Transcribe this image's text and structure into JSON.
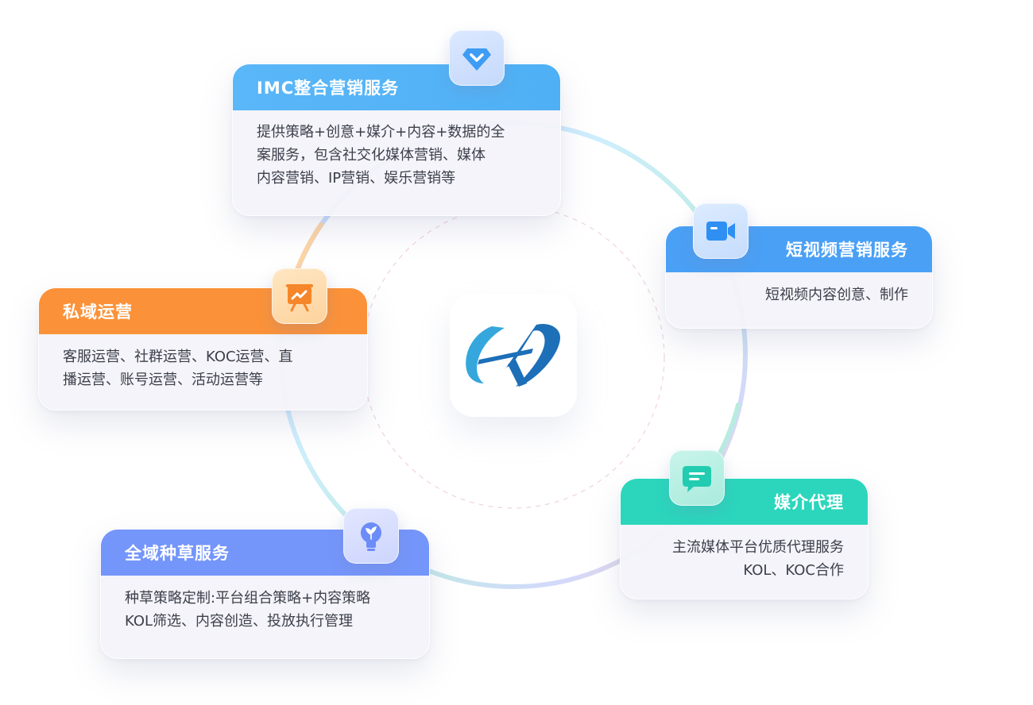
{
  "colors": {
    "imc": "#54b4f7",
    "short_video": "#4a9ff5",
    "private": "#fa9137",
    "media": "#2bd7bd",
    "grass": "#7494f9",
    "logo_blue": "#1d6fb8",
    "logo_light": "#35a7dd"
  },
  "logo": {
    "icon": "hv-logo-mark"
  },
  "cards": {
    "imc": {
      "title": "IMC整合营销服务",
      "lines": [
        "提供策略+创意+媒介+内容+数据的全",
        "案服务，包含社交化媒体营销、媒体",
        "内容营销、IP营销、娱乐营销等"
      ],
      "icon": "diamond-icon"
    },
    "short_video": {
      "title": "短视频营销服务",
      "lines": [
        "短视频内容创意、制作"
      ],
      "icon": "video-camera-icon"
    },
    "private": {
      "title": "私域运营",
      "lines": [
        "客服运营、社群运营、KOC运营、直",
        "播运营、账号运营、活动运营等"
      ],
      "icon": "presentation-chart-icon"
    },
    "media": {
      "title": "媒介代理",
      "lines": [
        "主流媒体平台优质代理服务",
        "KOL、KOC合作"
      ],
      "icon": "chat-bubble-icon"
    },
    "grass": {
      "title": "全域种草服务",
      "lines": [
        "种草策略定制:平台组合策略+内容策略",
        "KOL筛选、内容创造、投放执行管理"
      ],
      "icon": "lightbulb-sprout-icon"
    }
  }
}
